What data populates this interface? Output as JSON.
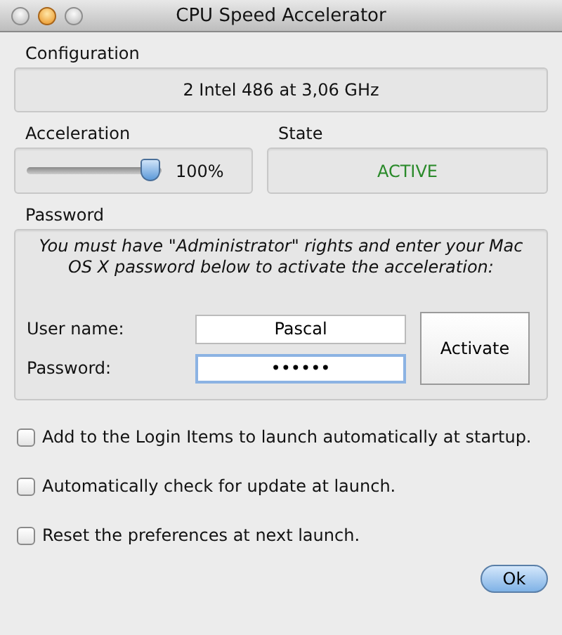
{
  "window": {
    "title": "CPU Speed Accelerator"
  },
  "configuration": {
    "label": "Configuration",
    "value": "2 Intel 486 at 3,06 GHz"
  },
  "acceleration": {
    "label": "Acceleration",
    "level": 1,
    "reading": "100%"
  },
  "state": {
    "label": "State",
    "value": "ACTIVE"
  },
  "password_section": {
    "label": "Password",
    "message": "You must have \"Administrator\" rights and enter your Mac OS X password below to activate the acceleration:",
    "user_name": {
      "label": "User name:",
      "value": "Pascal"
    },
    "password": {
      "label": "Password:",
      "value": "••••••"
    },
    "button": "Activate"
  },
  "options": [
    {
      "label": "Add to the Login Items to launch automatically at startup.",
      "checked": false
    },
    {
      "label": "Automatically check for update at launch.",
      "checked": false
    },
    {
      "label": "Reset the preferences at next launch.",
      "checked": false
    }
  ],
  "buttons": [
    "Ok"
  ]
}
